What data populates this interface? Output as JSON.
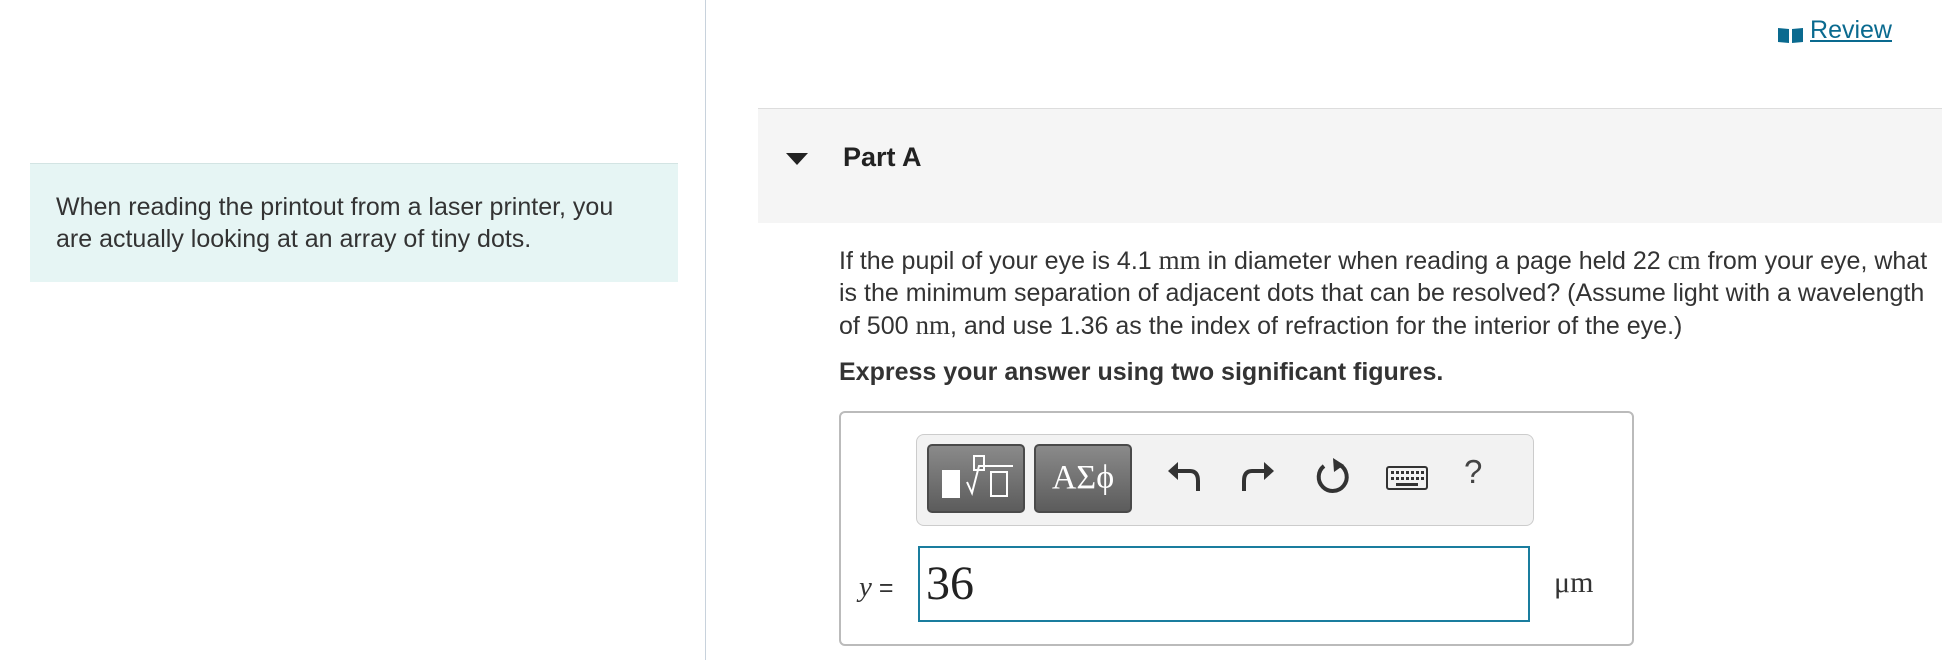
{
  "intro": {
    "text": "When reading the printout from a laser printer, you are actually looking at an array of tiny dots."
  },
  "header": {
    "review_link": "Review",
    "review_icon": "book-icon",
    "link_color": "#0a6a8f"
  },
  "part": {
    "title": "Part A",
    "toggle_icon": "caret-down-icon"
  },
  "question": {
    "t1": "If the pupil of your eye is 4.1",
    "u1": "mm",
    "t2": "in diameter when reading a page held 22",
    "u2": "cm",
    "t3": "from your eye, what is the minimum separation of adjacent dots that can be resolved? (Assume light with a wavelength of 500",
    "u3": "nm",
    "t4": ", and use 1.36 as the index of refraction for the interior of the eye.)",
    "instruction": "Express your answer using two significant figures."
  },
  "toolbar": {
    "greek_label": "ΑΣϕ",
    "help_label": "?",
    "icons": [
      "templates-icon",
      "greek-symbols-icon",
      "undo-icon",
      "redo-icon",
      "reset-icon",
      "keyboard-icon",
      "help-icon"
    ]
  },
  "answer": {
    "variable": "y",
    "equals": "=",
    "value": "36",
    "unit": "μm",
    "accent_color": "#1a7d9e"
  }
}
